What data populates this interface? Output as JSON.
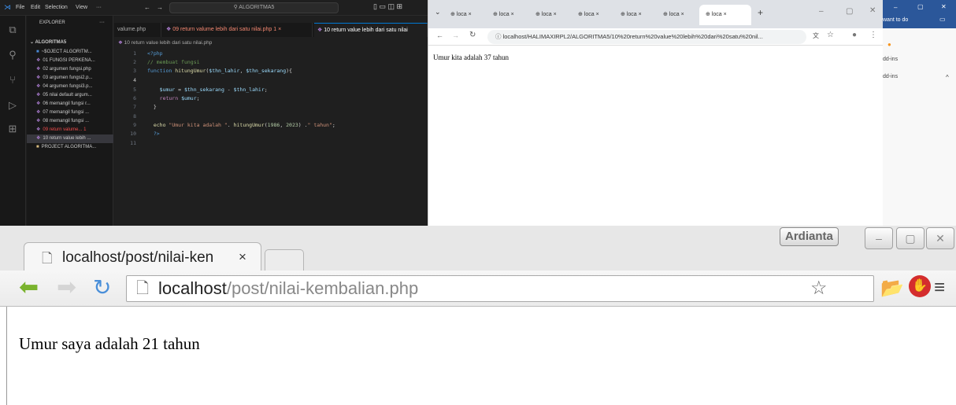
{
  "vscode": {
    "menu": [
      "File",
      "Edit",
      "Selection",
      "View",
      "···"
    ],
    "search": "ALGORITMA5",
    "explorer_title": "EXPLORER",
    "explorer_more": "···",
    "root": "ALGORITMA5",
    "files": [
      "~$OJECT ALGORITM...",
      "01 FUNGSI PERKENA...",
      "02 argumen fungsi.php",
      "03 argumen fungsi2.p...",
      "04 argumen fungsi3.p...",
      "05 nilai default argum...",
      "06 memangil fungsi r...",
      "07 memangil fungsi ...",
      "08 memangil fungsi ...",
      "09 return valume... 1",
      "10 return value lebih ...",
      "PROJECT ALGORITMA..."
    ],
    "tabs": [
      "valume.php",
      "09 return valume lebih dari satu nilai.php 1",
      "10 return value lebih dari satu nilai"
    ],
    "tab_close": "×",
    "breadcrumb": "10 return value lebih dari satu nilai.php",
    "line_numbers": [
      "1",
      "2",
      "3",
      "4",
      "5",
      "6",
      "7",
      "8",
      "9",
      "10",
      "11"
    ]
  },
  "chrome1": {
    "tab_label": "loca",
    "tab_close": "×",
    "new_tab": "+",
    "url": "localhost/HALIMAXIRPL2/ALGORITMA5/10%20return%20value%20lebih%20dari%20satu%20nil...",
    "content": "Umur kita adalah 37 tahun"
  },
  "word": {
    "tell_me": "want to do",
    "addins1": "dd-ins",
    "addins2": "dd-ins"
  },
  "chrome2": {
    "user": "Ardianta",
    "tab_title": "localhost/post/nilai-ken",
    "tab_close": "×",
    "url_host": "localhost",
    "url_path": "/post/nilai-kembalian.php",
    "content": "Umur saya adalah 21 tahun"
  }
}
